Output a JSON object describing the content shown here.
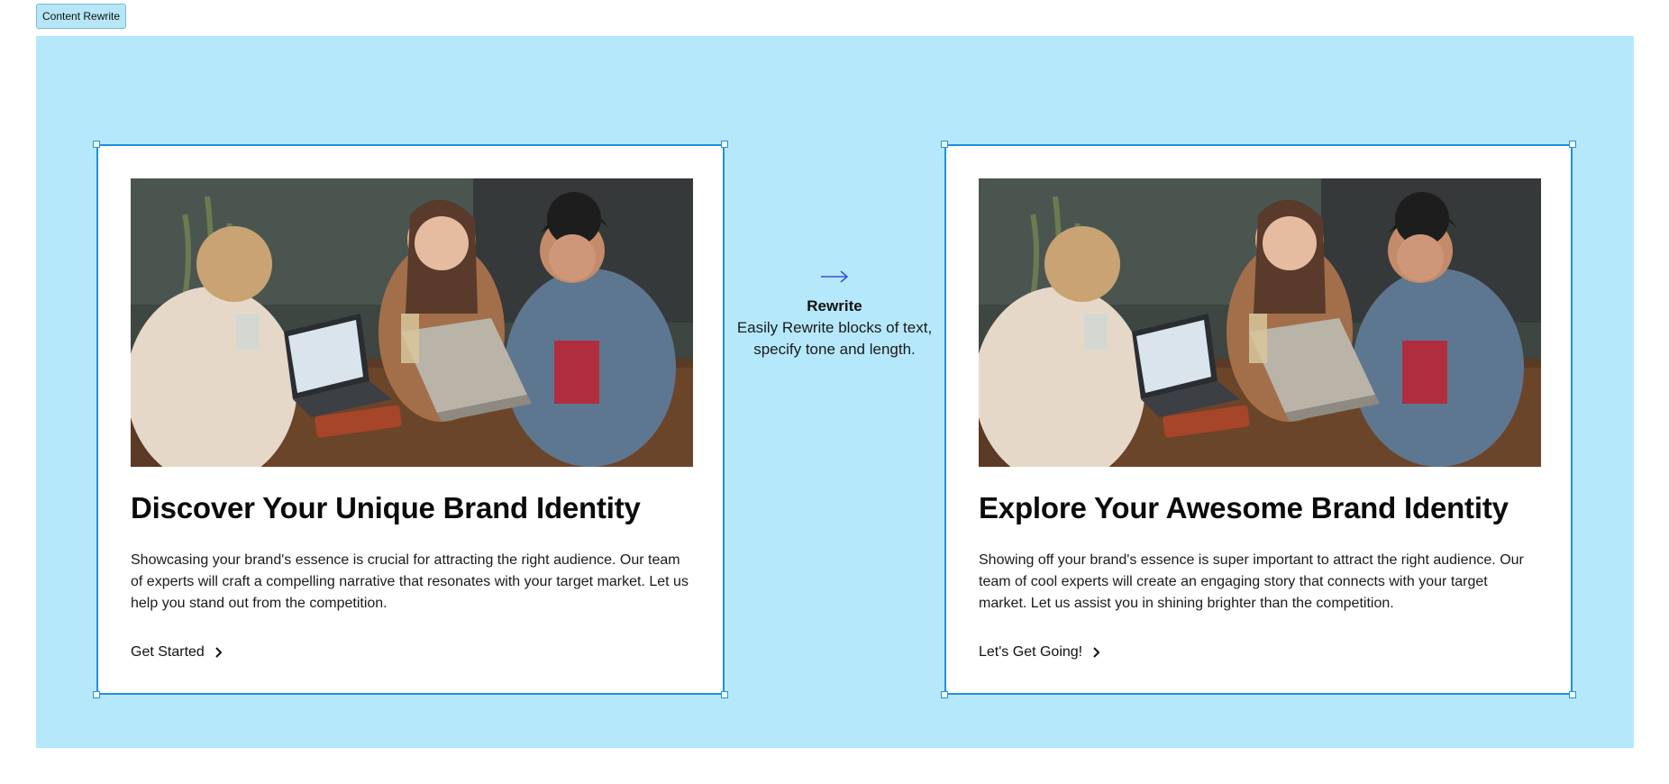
{
  "toolbar": {
    "tab_label": "Content Rewrite"
  },
  "middle": {
    "title": "Rewrite",
    "description": "Easily Rewrite blocks of text, specify tone and length."
  },
  "cards": [
    {
      "headline": "Discover Your Unique Brand Identity",
      "body": "Showcasing your brand's essence is crucial for attracting the right audience. Our team of experts will craft a compelling narrative that resonates with your target market. Let us help you stand out from the competition.",
      "cta": "Get Started"
    },
    {
      "headline": "Explore Your Awesome Brand Identity",
      "body": "Showing off your brand's essence is super important to attract the right audience. Our team of cool experts will create an engaging story that connects with your target market. Let us assist you in shining brighter than the competition.",
      "cta": "Let's Get Going!"
    }
  ],
  "colors": {
    "canvas_background": "#b6e8fb",
    "selection_border": "#1f8fe0",
    "arrow": "#3b4fd8"
  },
  "icons": {
    "arrow": "arrow-right-icon",
    "chevron": "chevron-right-icon"
  }
}
